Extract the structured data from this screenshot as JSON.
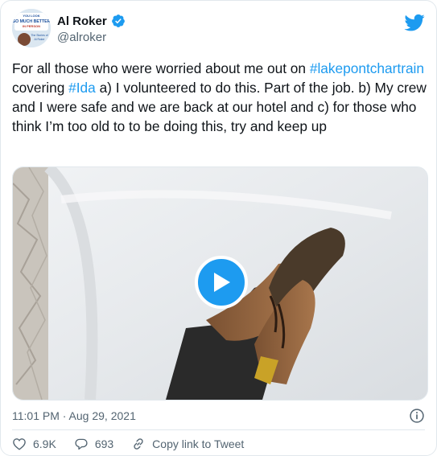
{
  "author": {
    "display_name": "Al Roker",
    "handle": "@alroker",
    "avatar_text": [
      "YOU LOOK",
      "SO MUCH BETTER",
      "IN PERSON",
      "The Stories of",
      "Al Roker"
    ]
  },
  "tweet": {
    "text_part1": "For all those who were worried about me out on ",
    "hashtag1": "#lakepontchartrain",
    "text_part2": " covering ",
    "hashtag2": "#Ida",
    "text_part3": " a) I volunteered to do this. Part of the job. b) My crew and I were safe and we are back at our hotel and c) for those who think I’m too old to to be doing this, try and keep up"
  },
  "meta": {
    "timestamp": "11:01 PM · Aug 29, 2021"
  },
  "actions": {
    "likes": "6.9K",
    "replies": "693",
    "copy_link": "Copy link to Tweet"
  },
  "colors": {
    "accent": "#1d9bf0",
    "text": "#0f1419",
    "secondary": "#536471",
    "like_red": "#e0245e"
  },
  "icons": [
    "verified-badge-icon",
    "twitter-bird-icon",
    "play-icon",
    "info-icon",
    "heart-icon",
    "reply-icon",
    "link-icon"
  ]
}
